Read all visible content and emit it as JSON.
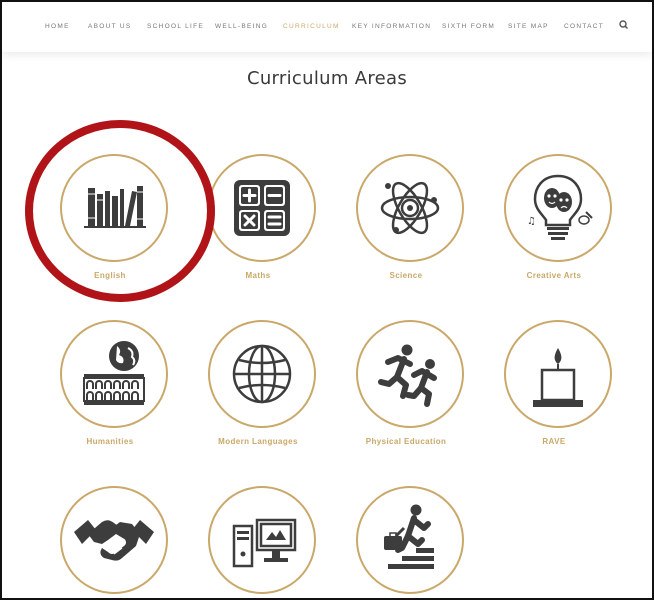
{
  "nav": {
    "items": [
      "HOME",
      "ABOUT US",
      "SCHOOL LIFE",
      "WELL-BEING",
      "CURRICULUM",
      "KEY INFORMATION",
      "SIXTH FORM",
      "SITE MAP",
      "CONTACT"
    ],
    "active": "CURRICULUM",
    "search_icon": "search-icon"
  },
  "page": {
    "title": "Curriculum Areas"
  },
  "areas": [
    {
      "label": "English",
      "icon": "books-icon"
    },
    {
      "label": "Maths",
      "icon": "calculator-icon"
    },
    {
      "label": "Science",
      "icon": "atom-icon"
    },
    {
      "label": "Creative Arts",
      "icon": "lightbulb-theatre-masks-icon"
    },
    {
      "label": "Humanities",
      "icon": "colosseum-globe-icon"
    },
    {
      "label": "Modern Languages",
      "icon": "globe-grid-icon"
    },
    {
      "label": "Physical Education",
      "icon": "running-figures-icon"
    },
    {
      "label": "RAVE",
      "icon": "candle-icon"
    },
    {
      "label": "",
      "icon": "handshake-icon"
    },
    {
      "label": "",
      "icon": "computer-monitor-icon"
    },
    {
      "label": "",
      "icon": "businesswoman-stairs-icon"
    }
  ],
  "colors": {
    "accent": "#c9a86a",
    "highlight": "#b01418",
    "icon": "#3d3d3d",
    "nav_text": "#777777"
  }
}
